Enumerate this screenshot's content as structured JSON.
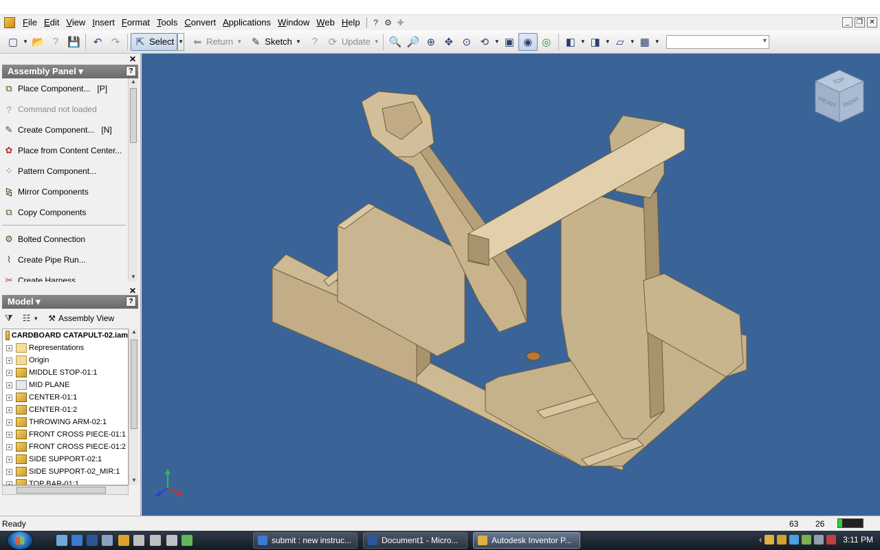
{
  "menubar": {
    "items": [
      "File",
      "Edit",
      "View",
      "Insert",
      "Format",
      "Tools",
      "Convert",
      "Applications",
      "Window",
      "Web",
      "Help"
    ]
  },
  "toolbar": {
    "select_label": "Select",
    "return_label": "Return",
    "sketch_label": "Sketch",
    "update_label": "Update"
  },
  "assembly_panel": {
    "title": "Assembly Panel",
    "commands": [
      {
        "label": "Place Component...",
        "shortcut": "[P]"
      },
      {
        "label": "Command not loaded",
        "shortcut": ""
      },
      {
        "label": "Create Component...",
        "shortcut": "[N]"
      },
      {
        "label": "Place from Content Center...",
        "shortcut": ""
      },
      {
        "label": "Pattern Component...",
        "shortcut": ""
      },
      {
        "label": "Mirror Components",
        "shortcut": ""
      },
      {
        "label": "Copy Components",
        "shortcut": ""
      },
      {
        "label": "Bolted Connection",
        "shortcut": ""
      },
      {
        "label": "Create Pipe Run...",
        "shortcut": ""
      },
      {
        "label": "Create Harness...",
        "shortcut": ""
      }
    ]
  },
  "model_panel": {
    "title": "Model",
    "view_label": "Assembly View",
    "root": "CARDBOARD CATAPULT-02.iam",
    "nodes": [
      "Representations",
      "Origin",
      "MIDDLE STOP-01:1",
      "MID PLANE",
      "CENTER-01:1",
      "CENTER-01:2",
      "THROWING ARM-02:1",
      "FRONT CROSS PIECE-01:1",
      "FRONT CROSS PIECE-01:2",
      "SIDE SUPPORT-02:1",
      "SIDE SUPPORT-02_MIR:1",
      "TOP BAR-01:1"
    ]
  },
  "viewcube": {
    "top": "TOP",
    "front": "FRONT",
    "right": "RIGHT"
  },
  "status": {
    "text": "Ready",
    "num1": "63",
    "num2": "26",
    "memory_level": 0.18
  },
  "taskbar": {
    "tasks": [
      {
        "label": "submit : new instruc...",
        "active": false
      },
      {
        "label": "Document1 - Micro...",
        "active": false
      },
      {
        "label": "Autodesk Inventor P...",
        "active": true
      }
    ],
    "clock": "3:11 PM"
  },
  "colors": {
    "viewport_bg": "#3a6498",
    "part_face": "#c8b58e",
    "part_edge": "#7d6a45"
  }
}
